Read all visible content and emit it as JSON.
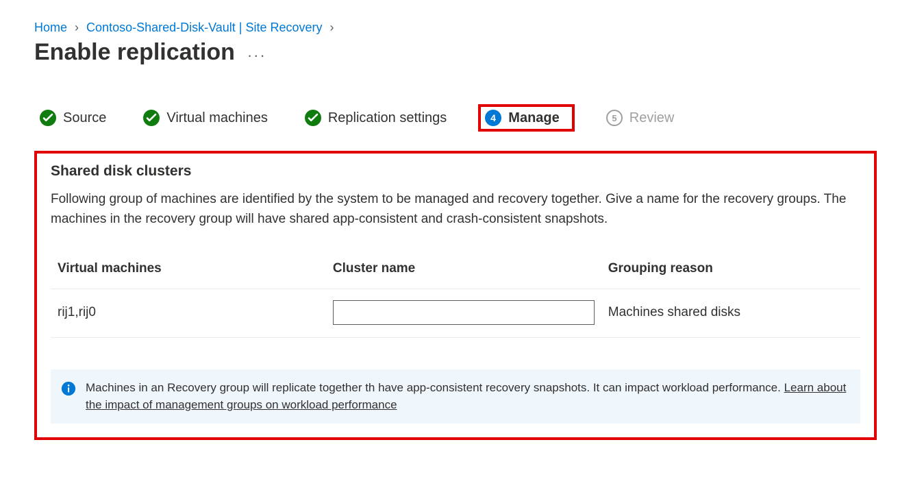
{
  "breadcrumb": {
    "home": "Home",
    "vault": "Contoso-Shared-Disk-Vault | Site Recovery"
  },
  "page": {
    "title": "Enable replication",
    "ellipsis": "···"
  },
  "tabs": {
    "source": "Source",
    "vm": "Virtual machines",
    "replication": "Replication settings",
    "manage": "Manage",
    "manage_number": "4",
    "review": "Review",
    "review_number": "5"
  },
  "panel": {
    "heading": "Shared disk clusters",
    "description": "Following group of machines are identified by the system to be managed and recovery together. Give a name for the recovery groups. The machines in the recovery group will have shared app-consistent and crash-consistent snapshots."
  },
  "table": {
    "headers": {
      "vm": "Virtual machines",
      "cluster": "Cluster name",
      "reason": "Grouping reason"
    },
    "row": {
      "vm": "rij1,rij0",
      "cluster": "",
      "reason": "Machines shared disks"
    }
  },
  "info": {
    "text": "Machines in an Recovery group will replicate together th have app-consistent recovery snapshots. It can impact workload performance. ",
    "link": "Learn about the impact of management groups on workload performance"
  }
}
